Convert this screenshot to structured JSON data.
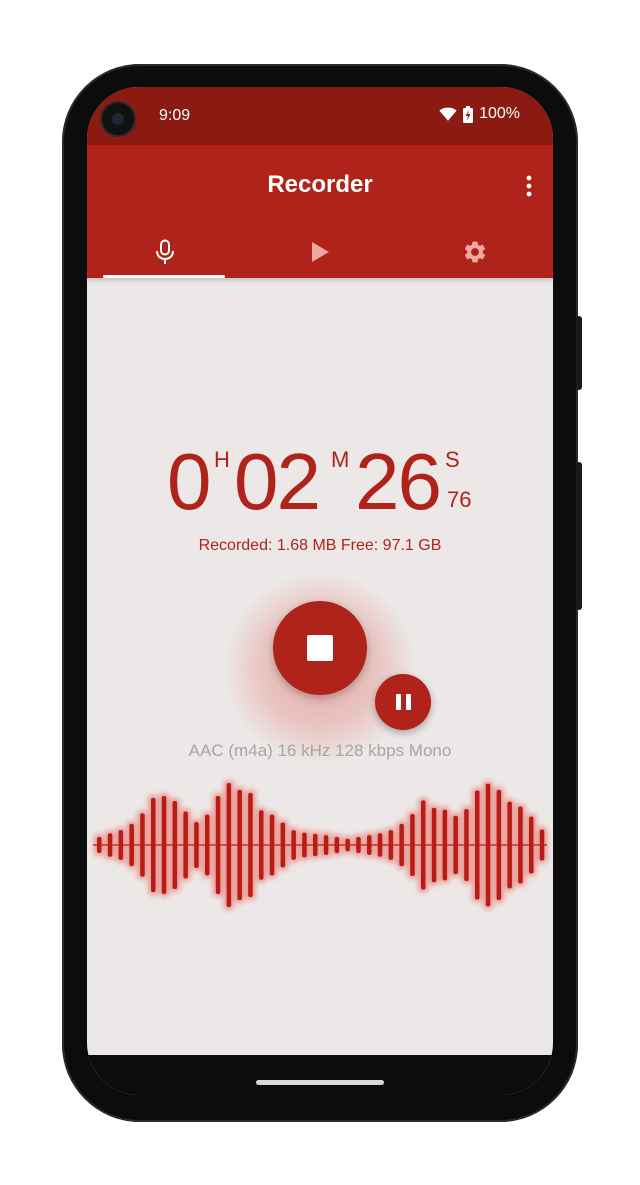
{
  "status_bar": {
    "time": "9:09",
    "battery": "100%",
    "icons": [
      "wifi-icon",
      "battery-charging-icon"
    ]
  },
  "toolbar": {
    "title": "Recorder",
    "overflow_icon": "more-vert-icon"
  },
  "tabs": [
    {
      "icon": "microphone-icon",
      "selected": true
    },
    {
      "icon": "play-icon",
      "selected": false
    },
    {
      "icon": "gear-icon",
      "selected": false
    }
  ],
  "timer": {
    "hours": "0",
    "hours_unit": "H",
    "minutes": "02",
    "minutes_unit": "M",
    "seconds": "26",
    "seconds_unit": "S",
    "hundredths": "76"
  },
  "recorded_info": "Recorded: 1.68 MB Free: 97.1 GB",
  "format_info": "AAC (m4a) 16 kHz 128 kbps Mono",
  "waveform": {
    "levels": [
      0.13,
      0.19,
      0.24,
      0.34,
      0.51,
      0.76,
      0.79,
      0.71,
      0.54,
      0.37,
      0.49,
      0.79,
      1.0,
      0.89,
      0.84,
      0.56,
      0.49,
      0.36,
      0.24,
      0.2,
      0.18,
      0.16,
      0.13,
      0.1,
      0.13,
      0.16,
      0.19,
      0.24,
      0.34,
      0.5,
      0.72,
      0.6,
      0.57,
      0.47,
      0.58,
      0.88,
      0.99,
      0.89,
      0.7,
      0.62,
      0.46,
      0.25
    ]
  },
  "colors": {
    "status_bar": "#8b1a12",
    "primary": "#b0231a",
    "background": "#ece8e7",
    "secondary_text": "#a9a5a4"
  }
}
